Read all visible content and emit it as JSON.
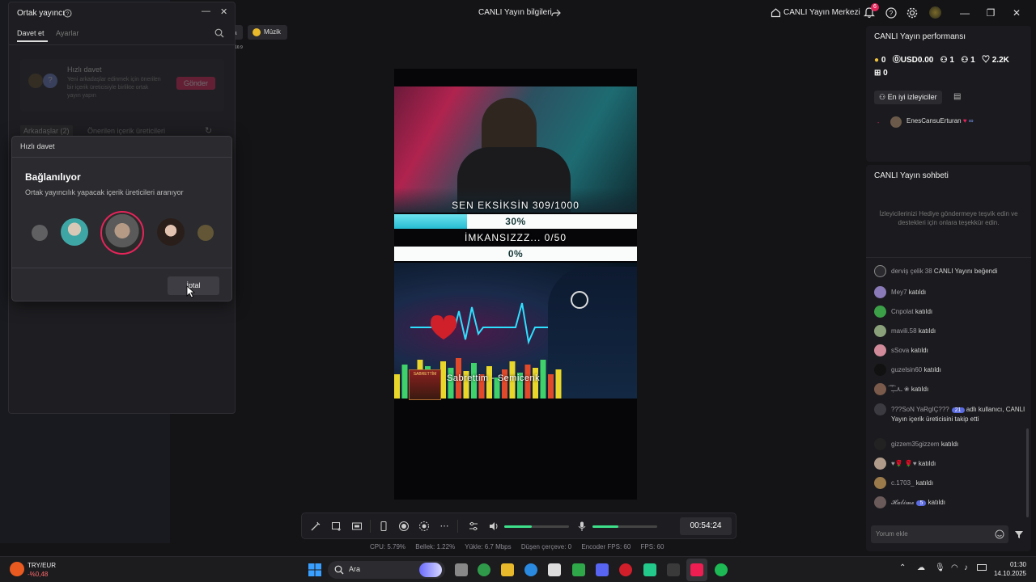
{
  "topbar": {
    "title": "CANLI Yayın bilgileri",
    "live_center": "CANLI Yayın Merkezi",
    "notif_count": "6",
    "category_partial": "a",
    "category_music": "Müzik",
    "time_label": "16:9"
  },
  "cohost": {
    "title": "Ortak yayıncı",
    "tab_invite": "Davet et",
    "tab_settings": "Ayarlar",
    "quick_invite_title": "Hızlı davet",
    "quick_invite_desc": "Yeni arkadaşlar edinmek için önerilen bir içerik üreticisiyle birlikte ortak yayın yapın",
    "send_button": "Gönder",
    "tab_friends": "Arkadaşlar (2)",
    "tab_suggested": "Önerilen içerik üreticileri"
  },
  "dialog": {
    "header": "Hızlı davet",
    "title": "Bağlanılıyor",
    "subtitle": "Ortak yayıncılık yapacak içerik üreticileri aranıyor",
    "cancel_button": "İptal"
  },
  "preview": {
    "goal1": "SEN EKSİKSİN  309/1000",
    "goal1_pct": "30%",
    "goal1_fill": 0.3,
    "goal2": "İMKANSIZZZ... 0/50",
    "goal2_pct": "0%",
    "goal2_fill": 0.0,
    "song": "Sabrettim - Semicenk",
    "album_text": "SABRETTİM"
  },
  "controls": {
    "timer": "00:54:24",
    "volume_level": 0.42,
    "mic_level": 0.4
  },
  "stats": {
    "cpu": "CPU:  5.79%",
    "memory": "Bellek:  1.22%",
    "upload": "Yükle:  6.7 Mbps",
    "dropped": "Düşen çerçeve:  0",
    "encoder_fps": "Encoder FPS:  60",
    "fps": "FPS:  60"
  },
  "performance": {
    "title": "CANLI Yayın performansı",
    "coins": "0",
    "usd": "USD0.00",
    "viewers": "1",
    "new_followers": "1",
    "likes": "2.2K",
    "gifts": "0",
    "top_viewers_tab": "En iyi izleyiciler",
    "top_viewer_name": "EnesCansuErturan"
  },
  "chat": {
    "title": "CANLI Yayın sohbeti",
    "hint": "İzleyicilerinizi Hediye göndermeye teşvik edin ve destekleri için onlara teşekkür edin.",
    "input_placeholder": "Yorum ekle",
    "items": [
      {
        "name": "derviş çelik 38",
        "action": "CANLI Yayını beğendi"
      },
      {
        "name": "Mey7",
        "action": "katıldı"
      },
      {
        "name": "Cnpolat",
        "action": "katıldı"
      },
      {
        "name": "mavili.58",
        "action": "katıldı"
      },
      {
        "name": "sSova",
        "action": "katıldı"
      },
      {
        "name": "guzelsin60",
        "action": "katıldı"
      },
      {
        "name": "ـ٨ـ̣ـ͡ـٰ͡ ❀",
        "action": "katıldı"
      },
      {
        "name": "???SoN YaRgIÇ???",
        "badge": "21",
        "action": "adlı kullanıcı, CANLI Yayın içerik üreticisini takip etti"
      },
      {
        "name": "gizzem35gizzem",
        "action": "katıldı"
      },
      {
        "name": "♥🌹 🌹♥",
        "action": "katıldı"
      },
      {
        "name": "c.1703_",
        "action": "katıldı"
      },
      {
        "name": "𝓗𝓪𝓵𝓲𝓶𝓮",
        "badge": "5",
        "action": "katıldı"
      }
    ]
  },
  "taskbar": {
    "currency": "TRY/EUR",
    "currency_change": "-%0,48",
    "search": "Ara",
    "time": "01:30",
    "date": "14.10.2025"
  },
  "colors": {
    "accent": "#e5245a",
    "goal_fill": "#3fd7e8",
    "volume": "#3ee08a"
  }
}
